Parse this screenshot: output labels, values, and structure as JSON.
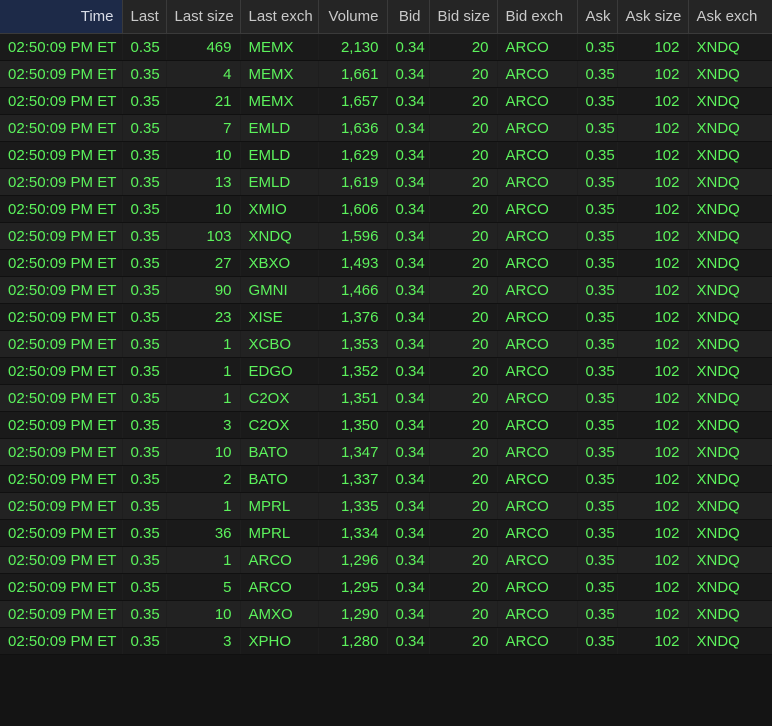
{
  "columns": [
    {
      "key": "time",
      "label": "Time"
    },
    {
      "key": "last",
      "label": "Last"
    },
    {
      "key": "last_size",
      "label": "Last size"
    },
    {
      "key": "last_exch",
      "label": "Last exch"
    },
    {
      "key": "volume",
      "label": "Volume"
    },
    {
      "key": "bid",
      "label": "Bid"
    },
    {
      "key": "bid_size",
      "label": "Bid size"
    },
    {
      "key": "bid_exch",
      "label": "Bid exch"
    },
    {
      "key": "ask",
      "label": "Ask"
    },
    {
      "key": "ask_size",
      "label": "Ask size"
    },
    {
      "key": "ask_exch",
      "label": "Ask exch"
    }
  ],
  "sorted_column": "time",
  "colors": {
    "row_text": "#5cf25c",
    "header_bg": "#252525",
    "sorted_header_bg": "#1d2a48",
    "background": "#141414"
  },
  "rows": [
    {
      "time": "02:50:09 PM ET",
      "last": "0.35",
      "last_size": "469",
      "last_exch": "MEMX",
      "volume": "2,130",
      "bid": "0.34",
      "bid_size": "20",
      "bid_exch": "ARCO",
      "ask": "0.35",
      "ask_size": "102",
      "ask_exch": "XNDQ"
    },
    {
      "time": "02:50:09 PM ET",
      "last": "0.35",
      "last_size": "4",
      "last_exch": "MEMX",
      "volume": "1,661",
      "bid": "0.34",
      "bid_size": "20",
      "bid_exch": "ARCO",
      "ask": "0.35",
      "ask_size": "102",
      "ask_exch": "XNDQ"
    },
    {
      "time": "02:50:09 PM ET",
      "last": "0.35",
      "last_size": "21",
      "last_exch": "MEMX",
      "volume": "1,657",
      "bid": "0.34",
      "bid_size": "20",
      "bid_exch": "ARCO",
      "ask": "0.35",
      "ask_size": "102",
      "ask_exch": "XNDQ"
    },
    {
      "time": "02:50:09 PM ET",
      "last": "0.35",
      "last_size": "7",
      "last_exch": "EMLD",
      "volume": "1,636",
      "bid": "0.34",
      "bid_size": "20",
      "bid_exch": "ARCO",
      "ask": "0.35",
      "ask_size": "102",
      "ask_exch": "XNDQ"
    },
    {
      "time": "02:50:09 PM ET",
      "last": "0.35",
      "last_size": "10",
      "last_exch": "EMLD",
      "volume": "1,629",
      "bid": "0.34",
      "bid_size": "20",
      "bid_exch": "ARCO",
      "ask": "0.35",
      "ask_size": "102",
      "ask_exch": "XNDQ"
    },
    {
      "time": "02:50:09 PM ET",
      "last": "0.35",
      "last_size": "13",
      "last_exch": "EMLD",
      "volume": "1,619",
      "bid": "0.34",
      "bid_size": "20",
      "bid_exch": "ARCO",
      "ask": "0.35",
      "ask_size": "102",
      "ask_exch": "XNDQ"
    },
    {
      "time": "02:50:09 PM ET",
      "last": "0.35",
      "last_size": "10",
      "last_exch": "XMIO",
      "volume": "1,606",
      "bid": "0.34",
      "bid_size": "20",
      "bid_exch": "ARCO",
      "ask": "0.35",
      "ask_size": "102",
      "ask_exch": "XNDQ"
    },
    {
      "time": "02:50:09 PM ET",
      "last": "0.35",
      "last_size": "103",
      "last_exch": "XNDQ",
      "volume": "1,596",
      "bid": "0.34",
      "bid_size": "20",
      "bid_exch": "ARCO",
      "ask": "0.35",
      "ask_size": "102",
      "ask_exch": "XNDQ"
    },
    {
      "time": "02:50:09 PM ET",
      "last": "0.35",
      "last_size": "27",
      "last_exch": "XBXO",
      "volume": "1,493",
      "bid": "0.34",
      "bid_size": "20",
      "bid_exch": "ARCO",
      "ask": "0.35",
      "ask_size": "102",
      "ask_exch": "XNDQ"
    },
    {
      "time": "02:50:09 PM ET",
      "last": "0.35",
      "last_size": "90",
      "last_exch": "GMNI",
      "volume": "1,466",
      "bid": "0.34",
      "bid_size": "20",
      "bid_exch": "ARCO",
      "ask": "0.35",
      "ask_size": "102",
      "ask_exch": "XNDQ"
    },
    {
      "time": "02:50:09 PM ET",
      "last": "0.35",
      "last_size": "23",
      "last_exch": "XISE",
      "volume": "1,376",
      "bid": "0.34",
      "bid_size": "20",
      "bid_exch": "ARCO",
      "ask": "0.35",
      "ask_size": "102",
      "ask_exch": "XNDQ"
    },
    {
      "time": "02:50:09 PM ET",
      "last": "0.35",
      "last_size": "1",
      "last_exch": "XCBO",
      "volume": "1,353",
      "bid": "0.34",
      "bid_size": "20",
      "bid_exch": "ARCO",
      "ask": "0.35",
      "ask_size": "102",
      "ask_exch": "XNDQ"
    },
    {
      "time": "02:50:09 PM ET",
      "last": "0.35",
      "last_size": "1",
      "last_exch": "EDGO",
      "volume": "1,352",
      "bid": "0.34",
      "bid_size": "20",
      "bid_exch": "ARCO",
      "ask": "0.35",
      "ask_size": "102",
      "ask_exch": "XNDQ"
    },
    {
      "time": "02:50:09 PM ET",
      "last": "0.35",
      "last_size": "1",
      "last_exch": "C2OX",
      "volume": "1,351",
      "bid": "0.34",
      "bid_size": "20",
      "bid_exch": "ARCO",
      "ask": "0.35",
      "ask_size": "102",
      "ask_exch": "XNDQ"
    },
    {
      "time": "02:50:09 PM ET",
      "last": "0.35",
      "last_size": "3",
      "last_exch": "C2OX",
      "volume": "1,350",
      "bid": "0.34",
      "bid_size": "20",
      "bid_exch": "ARCO",
      "ask": "0.35",
      "ask_size": "102",
      "ask_exch": "XNDQ"
    },
    {
      "time": "02:50:09 PM ET",
      "last": "0.35",
      "last_size": "10",
      "last_exch": "BATO",
      "volume": "1,347",
      "bid": "0.34",
      "bid_size": "20",
      "bid_exch": "ARCO",
      "ask": "0.35",
      "ask_size": "102",
      "ask_exch": "XNDQ"
    },
    {
      "time": "02:50:09 PM ET",
      "last": "0.35",
      "last_size": "2",
      "last_exch": "BATO",
      "volume": "1,337",
      "bid": "0.34",
      "bid_size": "20",
      "bid_exch": "ARCO",
      "ask": "0.35",
      "ask_size": "102",
      "ask_exch": "XNDQ"
    },
    {
      "time": "02:50:09 PM ET",
      "last": "0.35",
      "last_size": "1",
      "last_exch": "MPRL",
      "volume": "1,335",
      "bid": "0.34",
      "bid_size": "20",
      "bid_exch": "ARCO",
      "ask": "0.35",
      "ask_size": "102",
      "ask_exch": "XNDQ"
    },
    {
      "time": "02:50:09 PM ET",
      "last": "0.35",
      "last_size": "36",
      "last_exch": "MPRL",
      "volume": "1,334",
      "bid": "0.34",
      "bid_size": "20",
      "bid_exch": "ARCO",
      "ask": "0.35",
      "ask_size": "102",
      "ask_exch": "XNDQ"
    },
    {
      "time": "02:50:09 PM ET",
      "last": "0.35",
      "last_size": "1",
      "last_exch": "ARCO",
      "volume": "1,296",
      "bid": "0.34",
      "bid_size": "20",
      "bid_exch": "ARCO",
      "ask": "0.35",
      "ask_size": "102",
      "ask_exch": "XNDQ"
    },
    {
      "time": "02:50:09 PM ET",
      "last": "0.35",
      "last_size": "5",
      "last_exch": "ARCO",
      "volume": "1,295",
      "bid": "0.34",
      "bid_size": "20",
      "bid_exch": "ARCO",
      "ask": "0.35",
      "ask_size": "102",
      "ask_exch": "XNDQ"
    },
    {
      "time": "02:50:09 PM ET",
      "last": "0.35",
      "last_size": "10",
      "last_exch": "AMXO",
      "volume": "1,290",
      "bid": "0.34",
      "bid_size": "20",
      "bid_exch": "ARCO",
      "ask": "0.35",
      "ask_size": "102",
      "ask_exch": "XNDQ"
    },
    {
      "time": "02:50:09 PM ET",
      "last": "0.35",
      "last_size": "3",
      "last_exch": "XPHO",
      "volume": "1,280",
      "bid": "0.34",
      "bid_size": "20",
      "bid_exch": "ARCO",
      "ask": "0.35",
      "ask_size": "102",
      "ask_exch": "XNDQ"
    }
  ]
}
